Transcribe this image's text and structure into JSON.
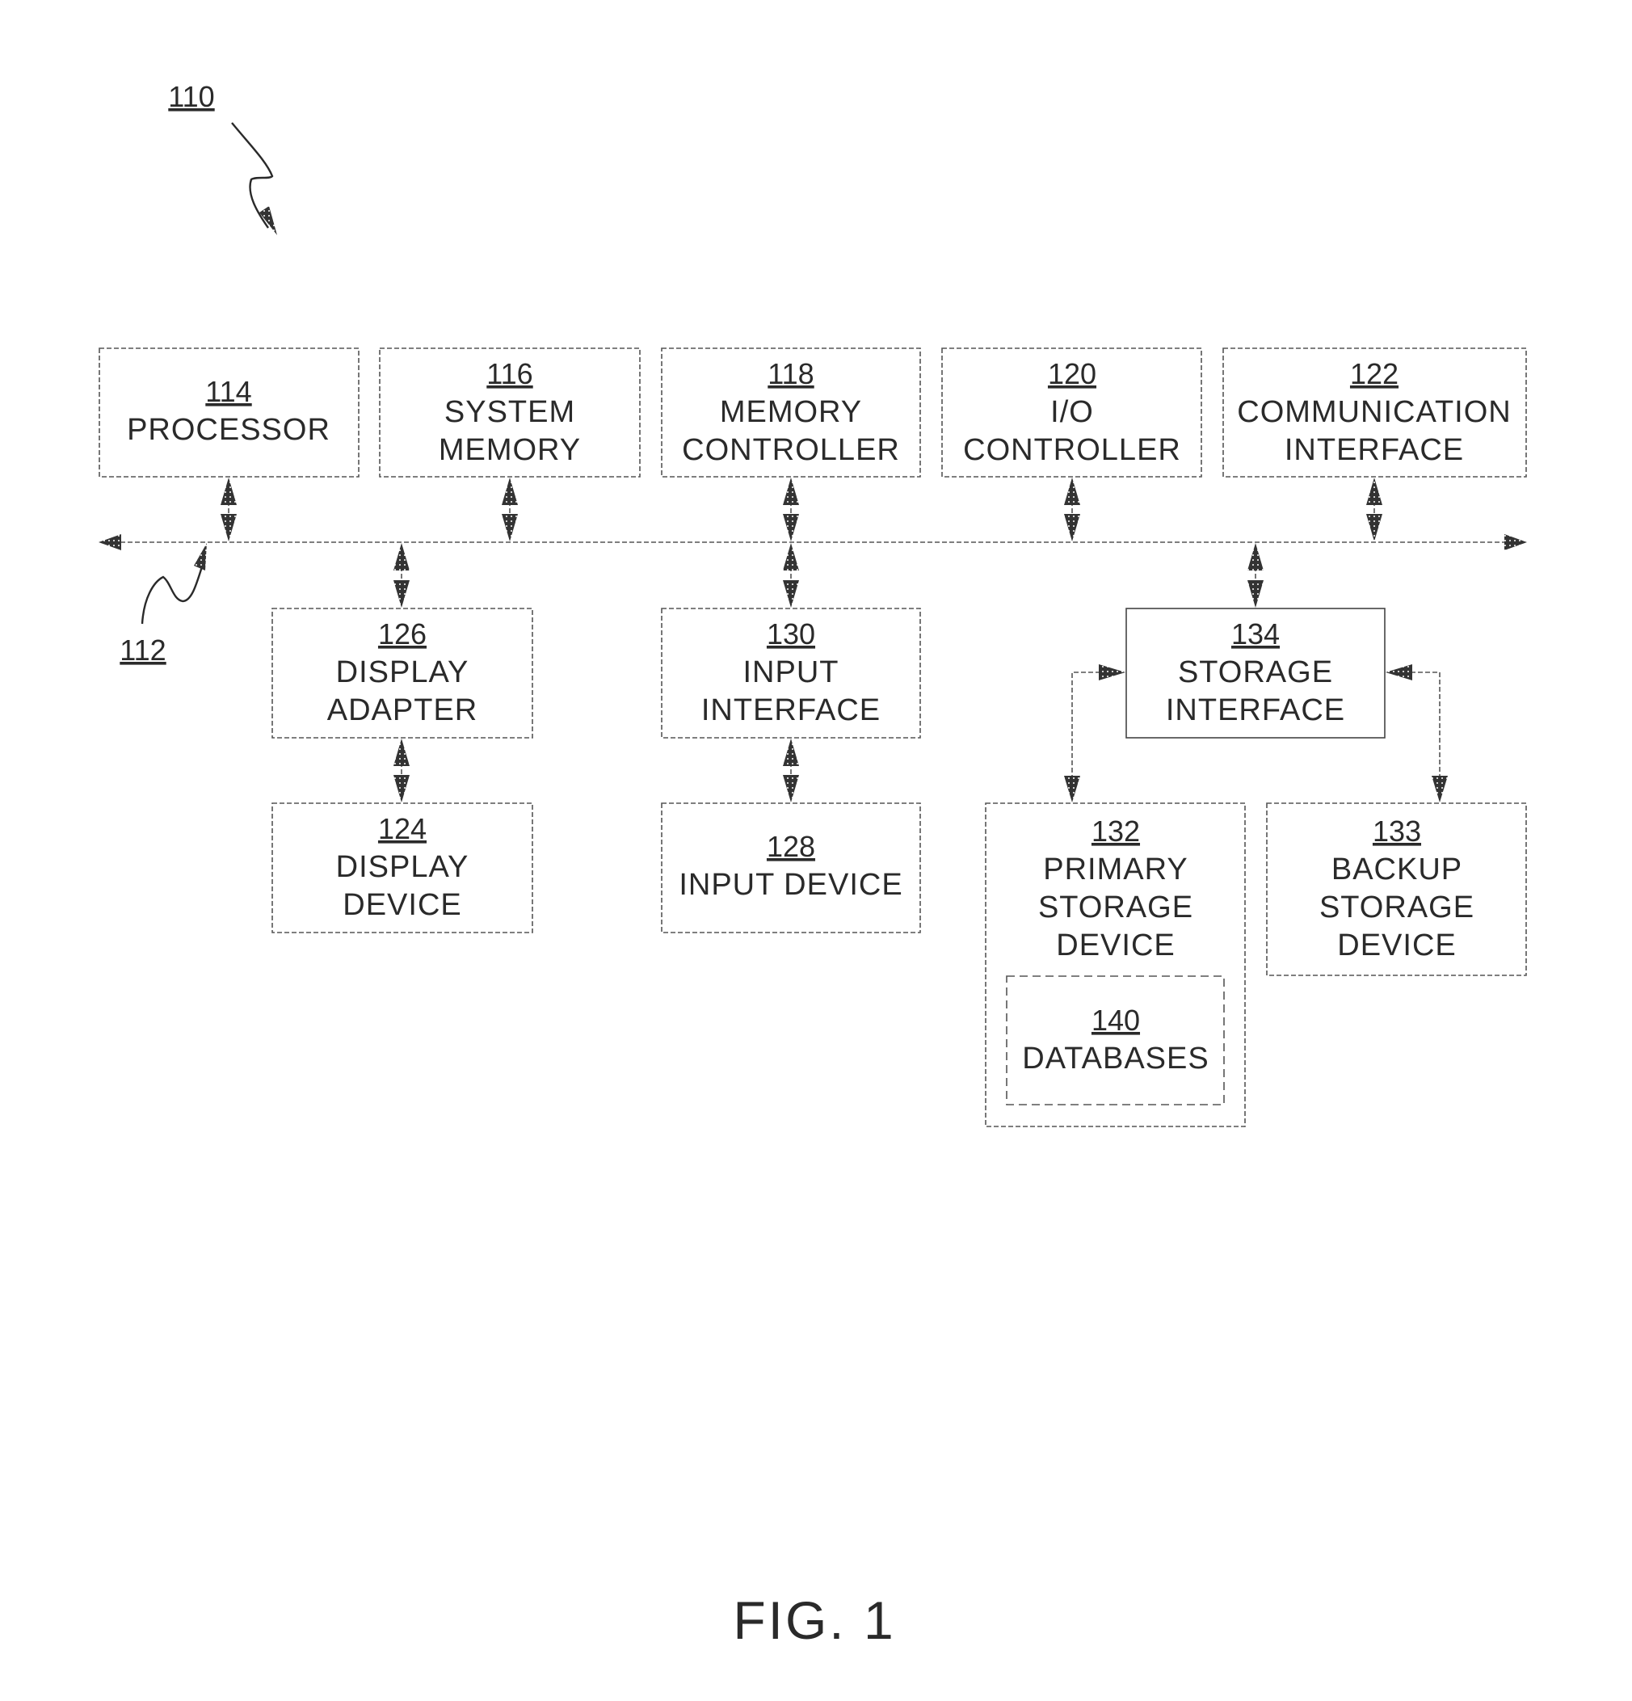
{
  "figure": {
    "caption": "FIG. 1",
    "system_ref": "110",
    "bus_ref": "112"
  },
  "blocks": {
    "processor": {
      "ref": "114",
      "lines": [
        "PROCESSOR"
      ]
    },
    "system_memory": {
      "ref": "116",
      "lines": [
        "SYSTEM",
        "MEMORY"
      ]
    },
    "memory_controller": {
      "ref": "118",
      "lines": [
        "MEMORY",
        "CONTROLLER"
      ]
    },
    "io_controller": {
      "ref": "120",
      "lines": [
        "I/O",
        "CONTROLLER"
      ]
    },
    "communication_interface": {
      "ref": "122",
      "lines": [
        "COMMUNICATION",
        "INTERFACE"
      ]
    },
    "display_adapter": {
      "ref": "126",
      "lines": [
        "DISPLAY",
        "ADAPTER"
      ]
    },
    "input_interface": {
      "ref": "130",
      "lines": [
        "INPUT",
        "INTERFACE"
      ]
    },
    "storage_interface": {
      "ref": "134",
      "lines": [
        "STORAGE",
        "INTERFACE"
      ]
    },
    "display_device": {
      "ref": "124",
      "lines": [
        "DISPLAY",
        "DEVICE"
      ]
    },
    "input_device": {
      "ref": "128",
      "lines": [
        "INPUT DEVICE"
      ]
    },
    "primary_storage_device": {
      "ref": "132",
      "lines": [
        "PRIMARY",
        "STORAGE",
        "DEVICE"
      ]
    },
    "backup_storage_device": {
      "ref": "133",
      "lines": [
        "BACKUP",
        "STORAGE",
        "DEVICE"
      ]
    },
    "databases": {
      "ref": "140",
      "lines": [
        "DATABASES"
      ]
    }
  }
}
